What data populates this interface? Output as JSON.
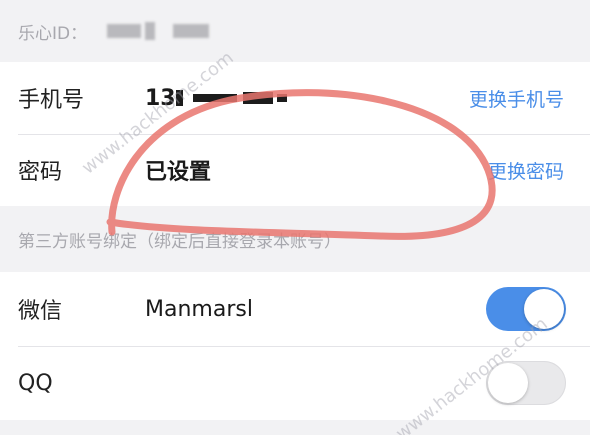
{
  "lexin_id": {
    "label": "乐心ID："
  },
  "account": {
    "phone": {
      "label": "手机号",
      "value_visible": "13",
      "action": "更换手机号"
    },
    "password": {
      "label": "密码",
      "value": "已设置",
      "action": "更换密码"
    }
  },
  "third_party": {
    "header": "第三方账号绑定（绑定后直接登录本账号）",
    "wechat": {
      "label": "微信",
      "value": "Manmarsl",
      "toggle_on": true
    },
    "qq": {
      "label": "QQ",
      "toggle_on": false
    }
  },
  "watermark": {
    "text_1": "www.hackhome.com",
    "text_2": "www.hackhome.com"
  },
  "colors": {
    "accent": "#4a8ee8",
    "annotation": "#e9756e"
  }
}
